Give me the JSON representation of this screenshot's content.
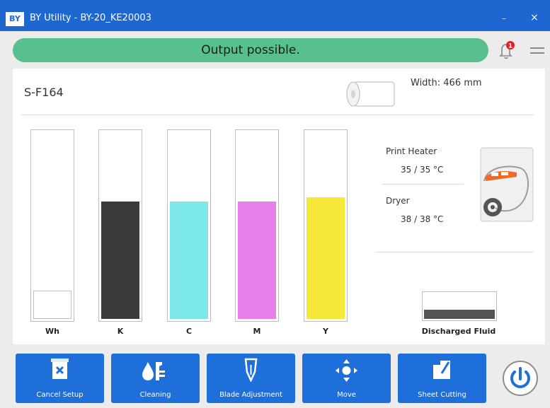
{
  "window": {
    "logo": "BY",
    "title": "BY Utility - BY-20_KE20003",
    "minimize": "–",
    "close": "×"
  },
  "status": {
    "text": "Output possible.",
    "notification_count": "1",
    "color": "#57c08c"
  },
  "media": {
    "name": "S-F164",
    "width_text": "Width: 466 mm"
  },
  "inks": [
    {
      "label": "Wh",
      "level": 0.15,
      "color": "#ffffff"
    },
    {
      "label": "K",
      "level": 0.63,
      "color": "#3a3a3a"
    },
    {
      "label": "C",
      "level": 0.63,
      "color": "#7de8ea"
    },
    {
      "label": "M",
      "level": 0.63,
      "color": "#e680e8"
    },
    {
      "label": "Y",
      "level": 0.65,
      "color": "#f6e83a"
    }
  ],
  "heaters": {
    "print_heater_label": "Print Heater",
    "print_heater_value": "35 / 35 °C",
    "dryer_label": "Dryer",
    "dryer_value": "38 / 38 °C"
  },
  "discharged_fluid": {
    "label": "Discharged Fluid",
    "level": 0.35
  },
  "toolbar": [
    {
      "label": "Cancel Setup",
      "icon": "cancel-setup-icon"
    },
    {
      "label": "Cleaning",
      "icon": "cleaning-icon"
    },
    {
      "label": "Blade Adjustment",
      "icon": "blade-adjustment-icon"
    },
    {
      "label": "Move",
      "icon": "move-icon"
    },
    {
      "label": "Sheet Cutting",
      "icon": "sheet-cutting-icon"
    }
  ],
  "colors": {
    "accent": "#1e6fd9",
    "titlebar": "#1e67d0",
    "badge": "#e02020"
  }
}
